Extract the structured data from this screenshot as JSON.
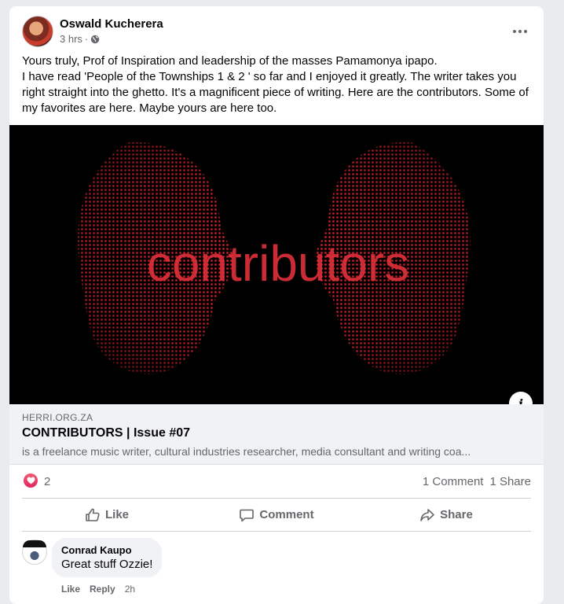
{
  "post": {
    "author": "Oswald Kucherera",
    "time": "3 hrs",
    "separator": "·",
    "text_lines": [
      "Yours truly, Prof of Inspiration and leadership of the masses Pamamonya ipapo.",
      "I have read 'People of the Townships 1 & 2 ' so far and I enjoyed it greatly. The writer takes you right straight into the ghetto. It's a magnificent piece of writing. Here are the contributors. Some of my favorites are here. Maybe yours are here too."
    ]
  },
  "image": {
    "overlay_text": "contributors",
    "colors": {
      "background": "#000000",
      "dots": "#d8202c",
      "text": "#e0303a"
    }
  },
  "link_preview": {
    "domain": "HERRI.ORG.ZA",
    "title": "CONTRIBUTORS | Issue #07",
    "description": "is a freelance music writer, cultural industries researcher, media consultant and writing coa..."
  },
  "stats": {
    "reaction_icon": "heart-icon",
    "reactions": "2",
    "comments": "1 Comment",
    "shares": "1 Share"
  },
  "actions": {
    "like": "Like",
    "comment": "Comment",
    "share": "Share"
  },
  "comment": {
    "author": "Conrad Kaupo",
    "text": "Great stuff Ozzie!",
    "like": "Like",
    "reply": "Reply",
    "time": "2h"
  }
}
